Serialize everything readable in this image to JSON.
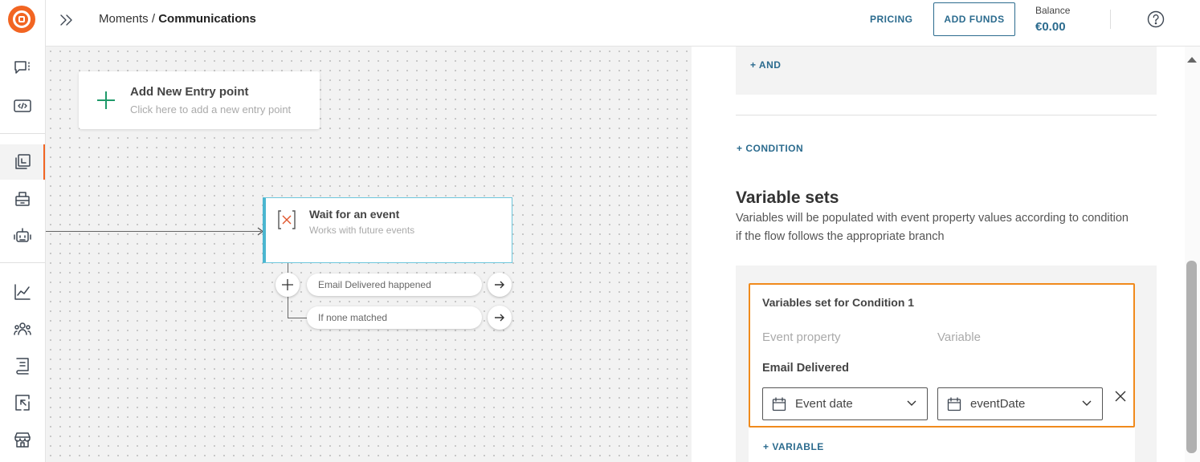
{
  "nav": {
    "items": [
      {
        "icon": "conversations-icon"
      },
      {
        "icon": "code-icon"
      },
      {
        "icon": "moments-icon",
        "active": true
      },
      {
        "icon": "broadcast-icon"
      },
      {
        "icon": "bot-icon"
      },
      {
        "icon": "analytics-icon"
      },
      {
        "icon": "people-icon"
      },
      {
        "icon": "logs-icon"
      },
      {
        "icon": "exports-icon"
      },
      {
        "icon": "store-icon"
      }
    ],
    "accent_color": "#f26522"
  },
  "header": {
    "breadcrumb_parent": "Moments",
    "breadcrumb_separator": " / ",
    "breadcrumb_current": "Communications",
    "pricing_label": "PRICING",
    "add_funds_label": "ADD FUNDS",
    "balance_label": "Balance",
    "balance_value": "€0.00"
  },
  "canvas": {
    "entry_point": {
      "title": "Add New Entry point",
      "subtitle": "Click here to add a new entry point"
    },
    "event_node": {
      "title": "Wait for an event",
      "subtitle": "Works with future events"
    },
    "branches": [
      {
        "label": "Email Delivered happened"
      },
      {
        "label": "If none matched"
      }
    ]
  },
  "panel": {
    "and_label": "+ AND",
    "condition_label": "+ CONDITION",
    "variable_sets_title": "Variable sets",
    "variable_sets_description": "Variables will be populated with event property values according to condition if the flow follows the appropriate branch",
    "card": {
      "title": "Variables set for Condition 1",
      "col_event_property": "Event property",
      "col_variable": "Variable",
      "event_name": "Email Delivered",
      "event_property_value": "Event date",
      "variable_value": "eventDate"
    },
    "add_variable_label": "+ VARIABLE",
    "highlight_color": "#f08a1c",
    "link_color": "#2b6b8e"
  }
}
